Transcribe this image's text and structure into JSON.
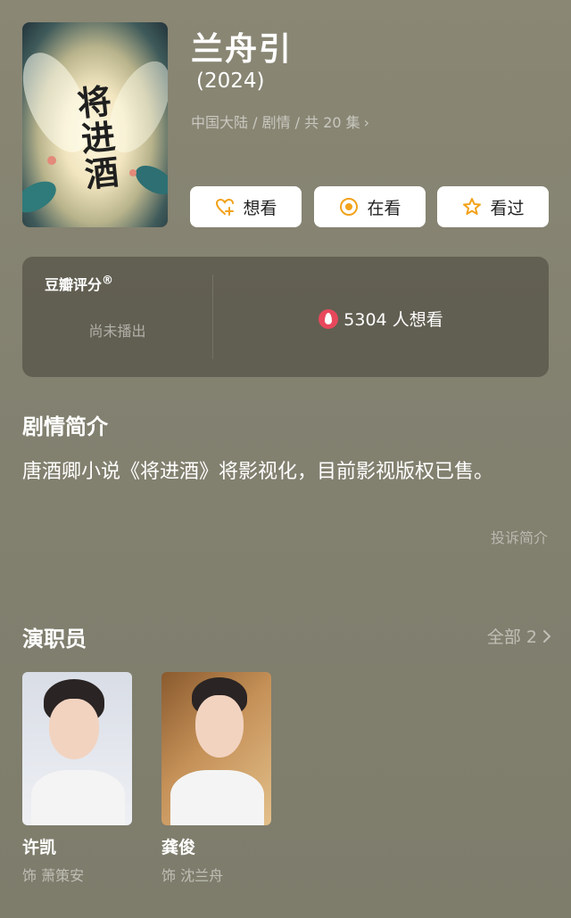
{
  "header": {
    "title": "兰舟引",
    "year": "(2024)",
    "meta": "中国大陆 / 剧情 / 共 20 集",
    "meta_chevron": "›",
    "poster_text": [
      "将",
      "进",
      "酒"
    ]
  },
  "actions": [
    {
      "label": "想看",
      "icon": "heart-plus-icon"
    },
    {
      "label": "在看",
      "icon": "target-circle-icon"
    },
    {
      "label": "看过",
      "icon": "star-outline-icon"
    }
  ],
  "rating": {
    "brand": "豆瓣评分",
    "brand_mark": "®",
    "status": "尚未播出",
    "wish_count": "5304 人想看"
  },
  "synopsis": {
    "title": "剧情简介",
    "text": "唐酒卿小说《将进酒》将影视化，目前影视版权已售。",
    "report": "投诉简介"
  },
  "cast": {
    "title": "演职员",
    "all_label": "全部 2",
    "members": [
      {
        "name": "许凯",
        "role": "饰 萧策安"
      },
      {
        "name": "龚俊",
        "role": "饰 沈兰舟"
      }
    ]
  },
  "colors": {
    "background": "#86836f",
    "accent_orange": "#f2a21b",
    "fire_red": "#e8485c"
  }
}
